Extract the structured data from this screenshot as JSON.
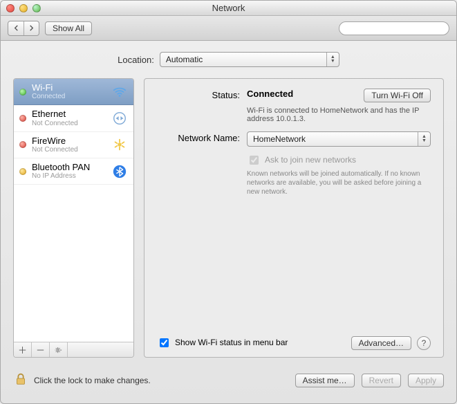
{
  "window": {
    "title": "Network"
  },
  "toolbar": {
    "show_all": "Show All",
    "search_placeholder": ""
  },
  "location": {
    "label": "Location:",
    "value": "Automatic"
  },
  "services": [
    {
      "name": "Wi-Fi",
      "sub": "Connected",
      "status": "green",
      "icon": "wifi-icon",
      "selected": true
    },
    {
      "name": "Ethernet",
      "sub": "Not Connected",
      "status": "red",
      "icon": "ethernet-icon",
      "selected": false
    },
    {
      "name": "FireWire",
      "sub": "Not Connected",
      "status": "red",
      "icon": "firewire-icon",
      "selected": false
    },
    {
      "name": "Bluetooth PAN",
      "sub": "No IP Address",
      "status": "yellow",
      "icon": "bluetooth-icon",
      "selected": false
    }
  ],
  "details": {
    "status_label": "Status:",
    "status_value": "Connected",
    "turn_off": "Turn Wi-Fi Off",
    "status_desc": "Wi-Fi is connected to HomeNetwork and has the IP address 10.0.1.3.",
    "network_name_label": "Network Name:",
    "network_name_value": "HomeNetwork",
    "ask_join": "Ask to join new networks",
    "ask_join_hint": "Known networks will be joined automatically. If no known networks are available, you will be asked before joining a new network.",
    "show_menu": "Show Wi-Fi status in menu bar",
    "advanced": "Advanced…",
    "help": "?"
  },
  "footer": {
    "lock_text": "Click the lock to make changes.",
    "assist": "Assist me…",
    "revert": "Revert",
    "apply": "Apply"
  }
}
